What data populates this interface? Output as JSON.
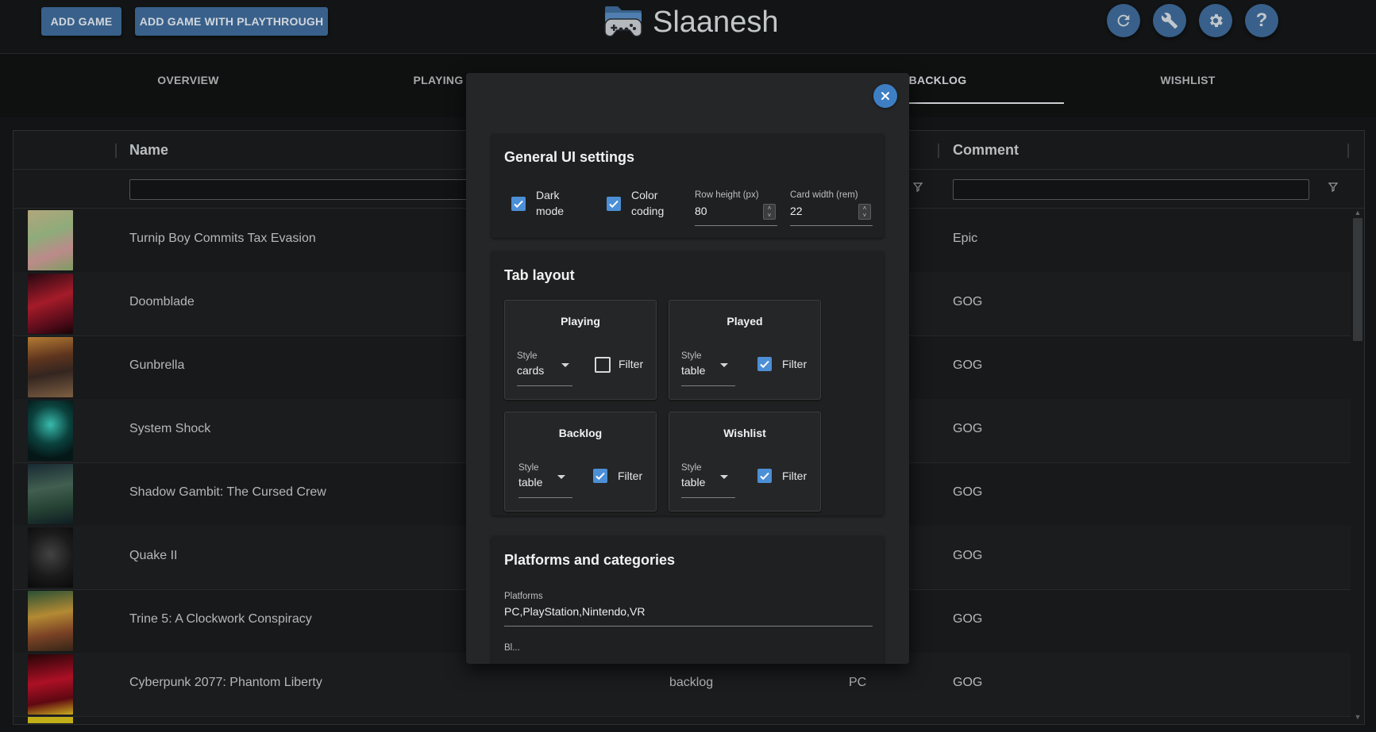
{
  "header": {
    "add_game_label": "ADD GAME",
    "add_game_playthrough_label": "ADD GAME WITH PLAYTHROUGH",
    "app_title": "Slaanesh",
    "icons": [
      "refresh-icon",
      "wrench-icon",
      "gear-icon",
      "help-icon"
    ]
  },
  "tabs": [
    {
      "label": "OVERVIEW"
    },
    {
      "label": "PLAYING"
    },
    {
      "label": "BACKLOG",
      "active": true
    },
    {
      "label": "WISHLIST"
    }
  ],
  "table": {
    "columns": {
      "name": "Name",
      "comment": "Comment"
    },
    "rows": [
      {
        "name": "Turnip Boy Commits Tax Evasion",
        "status": "",
        "platform": "",
        "comment": "Epic"
      },
      {
        "name": "Doomblade",
        "status": "",
        "platform": "",
        "comment": "GOG"
      },
      {
        "name": "Gunbrella",
        "status": "",
        "platform": "",
        "comment": "GOG"
      },
      {
        "name": "System Shock",
        "status": "",
        "platform": "",
        "comment": "GOG"
      },
      {
        "name": "Shadow Gambit: The Cursed Crew",
        "status": "",
        "platform": "",
        "comment": "GOG"
      },
      {
        "name": "Quake II",
        "status": "",
        "platform": "",
        "comment": "GOG"
      },
      {
        "name": "Trine 5: A Clockwork Conspiracy",
        "status": "",
        "platform": "",
        "comment": "GOG"
      },
      {
        "name": "Cyberpunk 2077: Phantom Liberty",
        "status": "backlog",
        "platform": "PC",
        "comment": "GOG"
      }
    ]
  },
  "dialog": {
    "general": {
      "title": "General UI settings",
      "dark_mode_line1": "Dark",
      "dark_mode_line2": "mode",
      "dark_mode_checked": true,
      "color_coding_line1": "Color",
      "color_coding_line2": "coding",
      "color_coding_checked": true,
      "row_height_label": "Row height (px)",
      "row_height_value": "80",
      "card_width_label": "Card width (rem)",
      "card_width_value": "22"
    },
    "tab_layout": {
      "title": "Tab layout",
      "style_label": "Style",
      "filter_label": "Filter",
      "tabs": [
        {
          "name": "Playing",
          "style": "cards",
          "filter": false
        },
        {
          "name": "Played",
          "style": "table",
          "filter": true
        },
        {
          "name": "Backlog",
          "style": "table",
          "filter": true
        },
        {
          "name": "Wishlist",
          "style": "table",
          "filter": true
        }
      ]
    },
    "platforms": {
      "title": "Platforms and categories",
      "platforms_label": "Platforms",
      "platforms_value": "PC,PlayStation,Nintendo,VR",
      "next_label": "Bl..."
    }
  },
  "colors": {
    "accent": "#3f6b9a",
    "checkbox": "#4c8fd6",
    "close_button": "#3e7fc4"
  }
}
